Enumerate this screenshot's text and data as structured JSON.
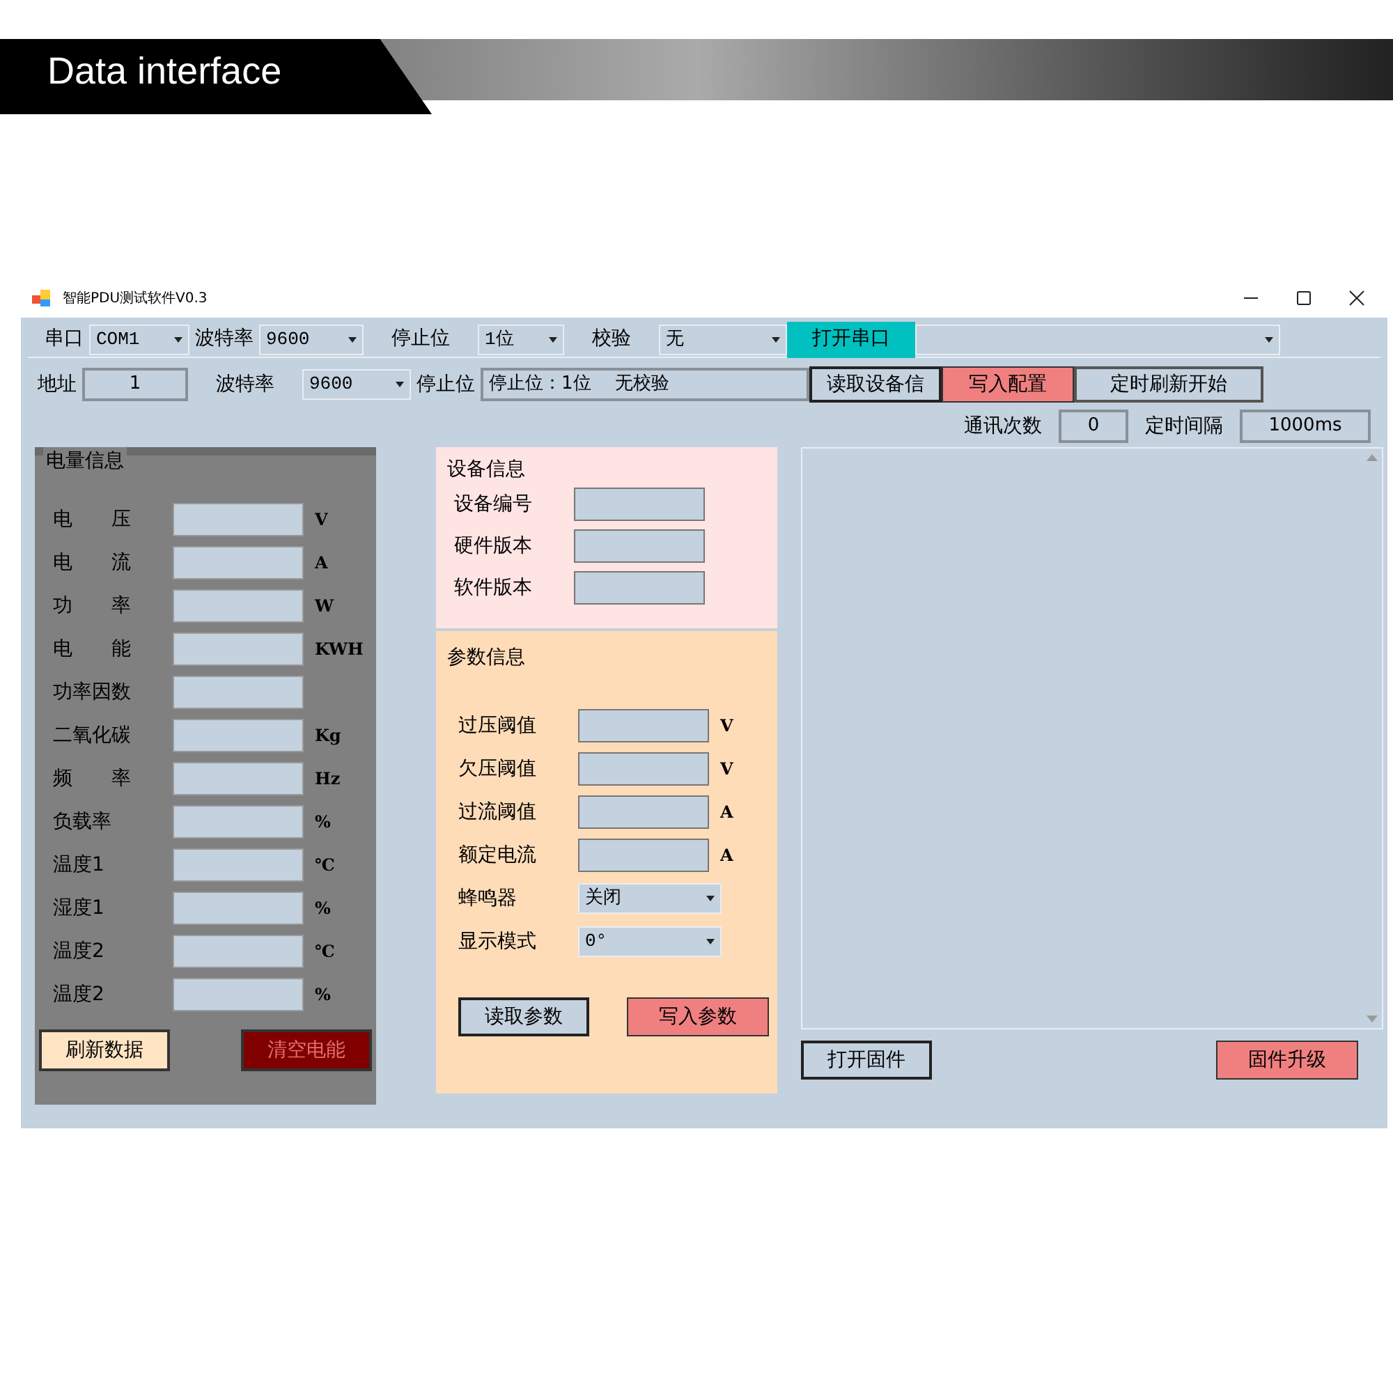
{
  "banner": {
    "title": "Data interface"
  },
  "window": {
    "title": "智能PDU测试软件V0.3"
  },
  "serial_bar": [
    {
      "kind": "label",
      "text": "串口"
    },
    {
      "kind": "combo",
      "value": "COM1"
    },
    {
      "kind": "label",
      "text": "波特率"
    },
    {
      "kind": "combo",
      "value": "9600"
    },
    {
      "kind": "label",
      "text": "停止位"
    },
    {
      "kind": "combo",
      "value": "1位"
    },
    {
      "kind": "label",
      "text": "校验"
    },
    {
      "kind": "combo",
      "value": "无"
    },
    {
      "kind": "button",
      "text": "打开串口"
    },
    {
      "kind": "combo"
    }
  ],
  "config_bar": [
    {
      "kind": "label",
      "text": "地址"
    },
    {
      "kind": "field",
      "value": "1"
    },
    {
      "kind": "label",
      "text": "波特率"
    },
    {
      "kind": "combo",
      "value": "9600"
    },
    {
      "kind": "label",
      "text": "停止位"
    },
    {
      "kind": "field",
      "value": "停止位：1位　 无校验"
    },
    {
      "kind": "button",
      "text": "读取设备信"
    },
    {
      "kind": "button",
      "text": "写入配置"
    },
    {
      "kind": "button",
      "text": "定时刷新开始"
    }
  ],
  "comm_bar": [
    {
      "kind": "label",
      "text": "通讯次数"
    },
    {
      "kind": "field",
      "value": "0"
    },
    {
      "kind": "label",
      "text": "定时间隔"
    },
    {
      "kind": "field",
      "value": "1000ms"
    }
  ],
  "power_panel": {
    "title": "电量信息",
    "rows": [
      {
        "label": "电　　压",
        "unit": "V"
      },
      {
        "label": "电　　流",
        "unit": "A"
      },
      {
        "label": "功　　率",
        "unit": "W"
      },
      {
        "label": "电　　能",
        "unit": "KWH"
      },
      {
        "label": "功率因数"
      },
      {
        "label": "二氧化碳",
        "unit": "Kg"
      },
      {
        "label": "频　　率",
        "unit": "Hz"
      },
      {
        "label": "负载率",
        "unit": "%"
      },
      {
        "label": "温度1",
        "unit": "℃"
      },
      {
        "label": "湿度1",
        "unit": "%"
      },
      {
        "label": "温度2",
        "unit": "℃"
      },
      {
        "label": "温度2",
        "unit": "%"
      }
    ],
    "buttons": [
      {
        "text": "刷新数据"
      },
      {
        "text": "清空电能"
      }
    ]
  },
  "device_panel": {
    "title": "设备信息",
    "rows": [
      {
        "label": "设备编号"
      },
      {
        "label": "硬件版本"
      },
      {
        "label": "软件版本"
      }
    ]
  },
  "param_panel": {
    "title": "参数信息",
    "rows": [
      {
        "kind": "field",
        "label": "过压阈值",
        "unit": "V"
      },
      {
        "kind": "field",
        "label": "欠压阈值",
        "unit": "V"
      },
      {
        "kind": "field",
        "label": "过流阈值",
        "unit": "A"
      },
      {
        "kind": "field",
        "label": "额定电流",
        "unit": "A"
      },
      {
        "kind": "combo",
        "label": "蜂鸣器",
        "value": "关闭"
      },
      {
        "kind": "combo",
        "label": "显示模式",
        "value": "0°"
      }
    ],
    "buttons": [
      {
        "text": "读取参数"
      },
      {
        "text": "写入参数"
      }
    ]
  },
  "firmware_panel": {
    "buttons": [
      {
        "text": "打开固件"
      },
      {
        "text": "固件升级"
      }
    ]
  }
}
